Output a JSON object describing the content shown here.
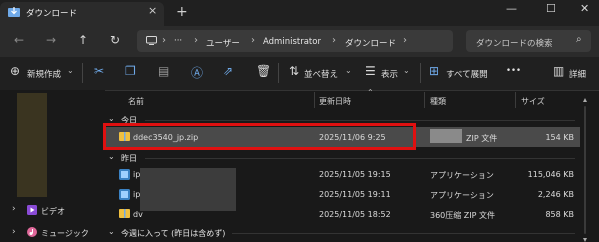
{
  "window": {
    "tab_title": "ダウンロード",
    "tab_close": "×",
    "new_tab": "+",
    "minimize": "—",
    "maximize": "☐",
    "close": "✕"
  },
  "nav": {
    "back": "←",
    "forward": "→",
    "up": "↑",
    "refresh": "↻"
  },
  "address": {
    "ellipsis": "···",
    "crumbs": [
      "ユーザー",
      "Administrator",
      "ダウンロード"
    ],
    "search_placeholder": "ダウンロードの検索"
  },
  "toolbar": {
    "new": "新規作成",
    "sort": "並べ替え",
    "view": "表示",
    "expand_all": "すべて展開",
    "more": "•••",
    "details": "詳細"
  },
  "columns": {
    "name": "名前",
    "modified": "更新日時",
    "type": "種類",
    "size": "サイズ"
  },
  "groups": {
    "today": "今日",
    "yesterday": "昨日",
    "earlier_this_week": "今週に入って (昨日は含めず)"
  },
  "files": [
    {
      "name": "ddec3540_jp.zip",
      "modified": "2025/11/06 9:25",
      "type": "ZIP 文件",
      "size": "154 KB",
      "icon": "zip-icon"
    },
    {
      "name": "ip",
      "modified": "2025/11/05 19:15",
      "type": "アプリケーション",
      "size": "115,046 KB",
      "icon": "app-icon"
    },
    {
      "name": "ip",
      "modified": "2025/11/05 19:11",
      "type": "アプリケーション",
      "size": "2,246 KB",
      "icon": "app-icon"
    },
    {
      "name": "dv",
      "modified": "2025/11/05 18:52",
      "type": "360压缩 ZIP 文件",
      "size": "858 KB",
      "icon": "zip-icon"
    }
  ],
  "sidebar": {
    "videos": "ビデオ",
    "music": "ミュージック"
  },
  "colors": {
    "accent": "#6fa9e8",
    "highlight": "#e01010",
    "folder": "#f0c040"
  }
}
